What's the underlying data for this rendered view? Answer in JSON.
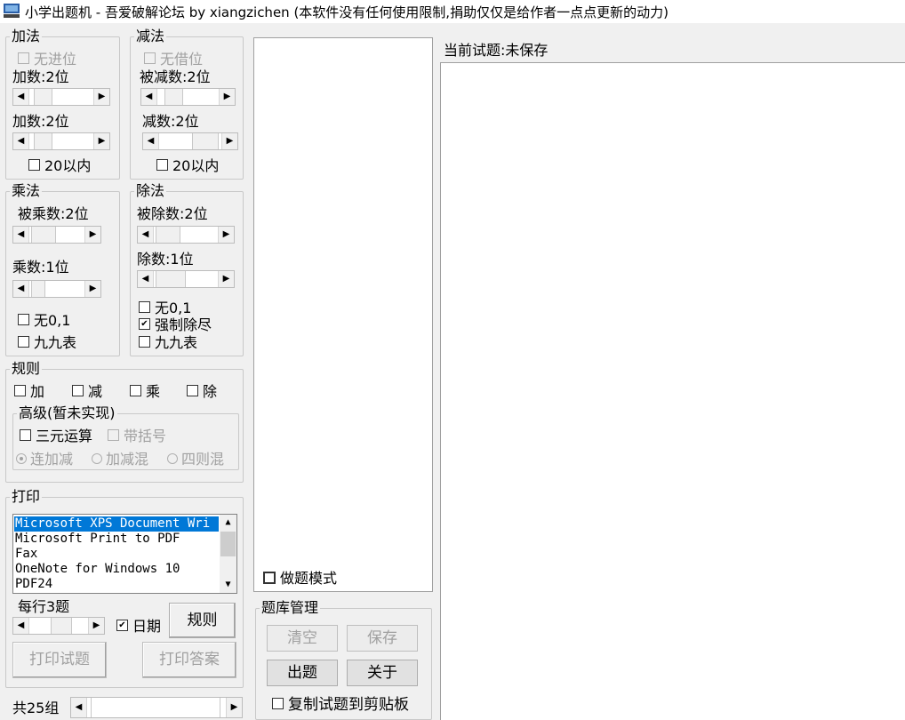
{
  "window": {
    "title": "小学出题机 - 吾爱破解论坛 by xiangzichen (本软件没有任何使用限制,捐助仅仅是给作者一点点更新的动力)"
  },
  "add": {
    "legend": "加法",
    "no_carry": "无进位",
    "addend1_label": "加数:2位",
    "addend1_value": 2,
    "addend2_label": "加数:2位",
    "addend2_value": 2,
    "within20": "20以内"
  },
  "sub": {
    "legend": "减法",
    "no_borrow": "无借位",
    "minuend_label": "被减数:2位",
    "minuend_value": 2,
    "subtrahend_label": "减数:2位",
    "subtrahend_value": 2,
    "within20": "20以内"
  },
  "mul": {
    "legend": "乘法",
    "multiplicand_label": "被乘数:2位",
    "multiplicand_value": 2,
    "multiplier_label": "乘数:1位",
    "multiplier_value": 1,
    "no01": "无0,1",
    "times_table": "九九表"
  },
  "div": {
    "legend": "除法",
    "dividend_label": "被除数:2位",
    "dividend_value": 2,
    "divisor_label": "除数:1位",
    "divisor_value": 1,
    "no01": "无0,1",
    "exact": "强制除尽",
    "exact_checked": true,
    "times_table": "九九表"
  },
  "rules": {
    "legend": "规则",
    "ops": [
      "加",
      "减",
      "乘",
      "除"
    ],
    "advanced_legend": "高级(暂未实现)",
    "three_operand": "三元运算",
    "brackets": "带括号",
    "modes": [
      "连加减",
      "加减混",
      "四则混"
    ],
    "selected_mode": "连加减"
  },
  "print": {
    "legend": "打印",
    "printers": [
      "Microsoft XPS Document Wri",
      "Microsoft Print to PDF",
      "Fax",
      "OneNote for Windows 10",
      "PDF24"
    ],
    "selected_printer": "Microsoft XPS Document Wri",
    "per_row_label": "每行3题",
    "per_row_value": 3,
    "date_label": "日期",
    "date_checked": true,
    "rules_button": "规则",
    "print_questions": "打印试题",
    "print_answers": "打印答案"
  },
  "footer": {
    "groups_label": "共25组",
    "groups_value": 25
  },
  "practice_mode": "做题模式",
  "bank": {
    "legend": "题库管理",
    "clear": "清空",
    "save": "保存",
    "generate": "出题",
    "about": "关于",
    "copy_to_clipboard": "复制试题到剪贴板"
  },
  "current": {
    "label": "当前试题:未保存"
  }
}
